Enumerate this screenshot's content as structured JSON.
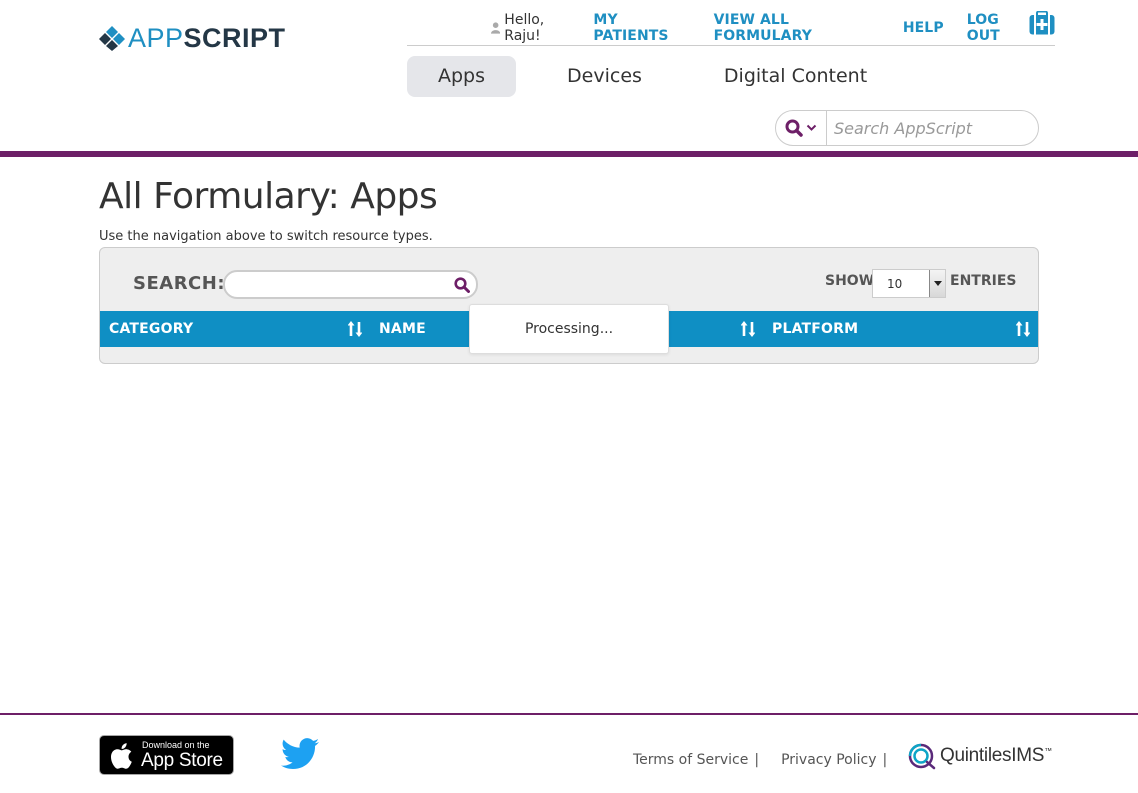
{
  "header": {
    "logo": {
      "part1": "APP",
      "part2": "SCRIPT"
    },
    "greeting": "Hello, Raju!",
    "links": [
      {
        "label": "MY PATIENTS"
      },
      {
        "label": "VIEW ALL FORMULARY"
      },
      {
        "label": "HELP"
      },
      {
        "label": "LOG OUT"
      }
    ],
    "tabs": [
      {
        "label": "Apps",
        "active": true
      },
      {
        "label": "Devices",
        "active": false
      },
      {
        "label": "Digital Content",
        "active": false
      }
    ],
    "search": {
      "placeholder": "Search AppScript"
    }
  },
  "main": {
    "title": "All Formulary: Apps",
    "subtitle": "Use the navigation above to switch resource types.",
    "table": {
      "search_label": "SEARCH:",
      "show_label": "SHOW",
      "entries_value": "10",
      "entries_label": "ENTRIES",
      "columns": [
        "CATEGORY",
        "NAME",
        "PLATFORM"
      ],
      "processing": "Processing..."
    }
  },
  "footer": {
    "appstore": {
      "line1": "Download on the",
      "line2": "App Store"
    },
    "links": [
      {
        "label": "Terms of Service",
        "sep": "|"
      },
      {
        "label": "Privacy Policy",
        "sep": "|"
      }
    ],
    "brand": "QuintilesIMS",
    "brand_tm": "™"
  },
  "colors": {
    "accent_blue": "#1f8fc2",
    "table_header": "#0f8fc4",
    "brand_purple": "#6d1f67"
  }
}
